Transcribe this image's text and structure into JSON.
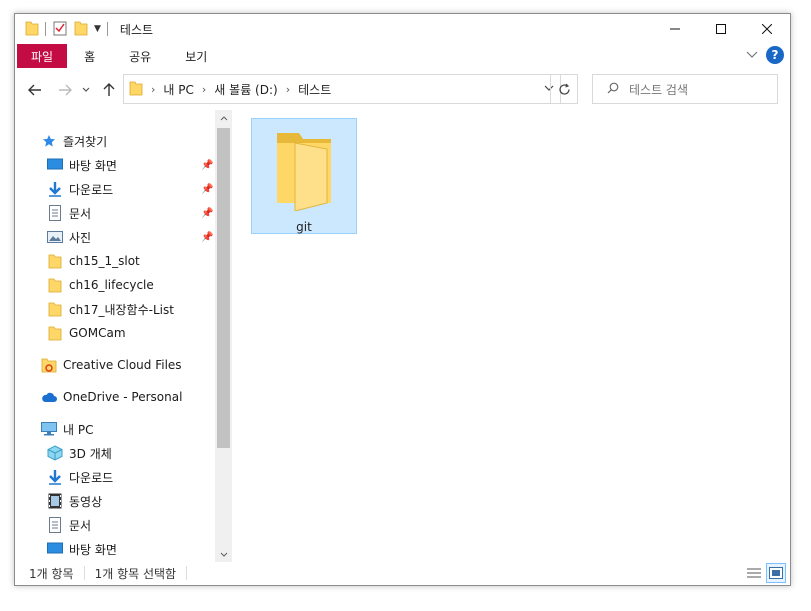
{
  "window": {
    "title": "테스트"
  },
  "ribbon": {
    "tabs": [
      "파일",
      "홈",
      "공유",
      "보기"
    ]
  },
  "address": {
    "crumbs": [
      "내 PC",
      "새 볼륨 (D:)",
      "테스트"
    ]
  },
  "search": {
    "placeholder": "테스트 검색"
  },
  "nav": {
    "quick_access": "즐겨찾기",
    "items": [
      {
        "label": "바탕 화면",
        "icon": "desktop-icon",
        "pinned": true
      },
      {
        "label": "다운로드",
        "icon": "download-icon",
        "pinned": true
      },
      {
        "label": "문서",
        "icon": "document-icon",
        "pinned": true
      },
      {
        "label": "사진",
        "icon": "pictures-icon",
        "pinned": true
      },
      {
        "label": "ch15_1_slot",
        "icon": "folder-icon",
        "pinned": false
      },
      {
        "label": "ch16_lifecycle",
        "icon": "folder-icon",
        "pinned": false
      },
      {
        "label": "ch17_내장함수-List",
        "icon": "folder-icon",
        "pinned": false
      },
      {
        "label": "GOMCam",
        "icon": "folder-icon",
        "pinned": false
      }
    ],
    "creative_cloud": "Creative Cloud Files",
    "onedrive": "OneDrive - Personal",
    "this_pc": "내 PC",
    "pc_items": [
      {
        "label": "3D 개체",
        "icon": "3d-objects-icon"
      },
      {
        "label": "다운로드",
        "icon": "download-icon"
      },
      {
        "label": "동영상",
        "icon": "video-icon"
      },
      {
        "label": "문서",
        "icon": "document-icon"
      },
      {
        "label": "바탕 화면",
        "icon": "desktop-icon"
      }
    ]
  },
  "content": {
    "items": [
      {
        "name": "git",
        "type": "folder",
        "selected": true
      }
    ]
  },
  "status": {
    "count": "1개 항목",
    "selected": "1개 항목 선택함"
  },
  "colors": {
    "file_tab": "#c40c44",
    "selection": "#cce8ff",
    "folder": "#ffd766"
  }
}
